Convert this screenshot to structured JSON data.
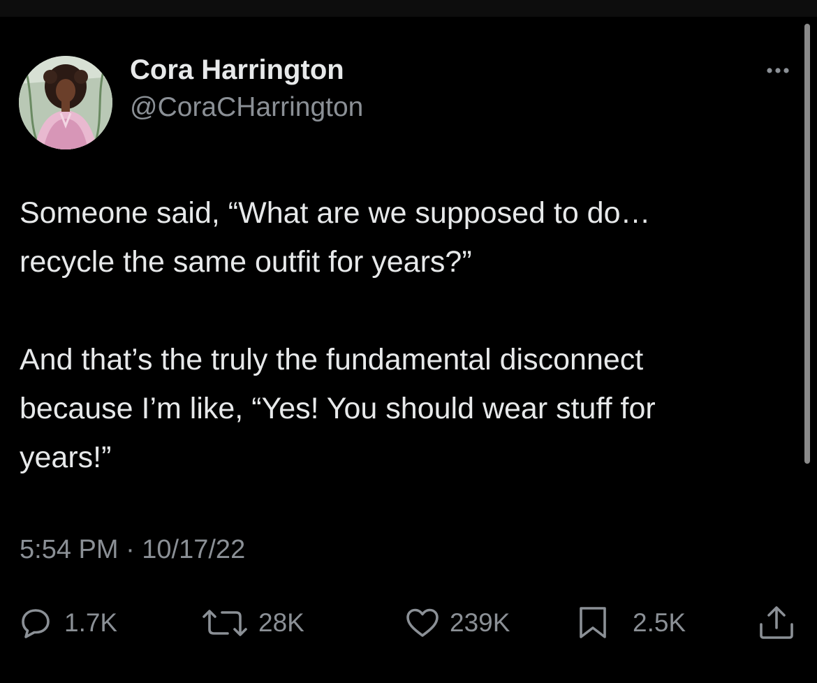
{
  "tweet": {
    "author": {
      "name": "Cora Harrington",
      "handle": "@CoraCHarrington",
      "avatar": "illustrated-portrait-avatar"
    },
    "more_icon": "more-horizontal-icon",
    "text": {
      "line1": "Someone said, “What are we supposed to do…",
      "line2": "recycle the same outfit for years?”",
      "line3": "And that’s the truly the fundamental disconnect",
      "line4": "because I’m like, “Yes! You should wear stuff for",
      "line5": "years!”"
    },
    "timestamp": "5:54 PM · 10/17/22",
    "actions": {
      "reply": {
        "icon": "reply-icon",
        "count": "1.7K"
      },
      "retweet": {
        "icon": "retweet-icon",
        "count": "28K"
      },
      "like": {
        "icon": "heart-icon",
        "count": "239K"
      },
      "bookmark": {
        "icon": "bookmark-icon",
        "count": "2.5K"
      },
      "share": {
        "icon": "share-icon"
      }
    }
  },
  "colors": {
    "background": "#000000",
    "primary_text": "#e7e9ea",
    "secondary_text": "#8b9096"
  }
}
